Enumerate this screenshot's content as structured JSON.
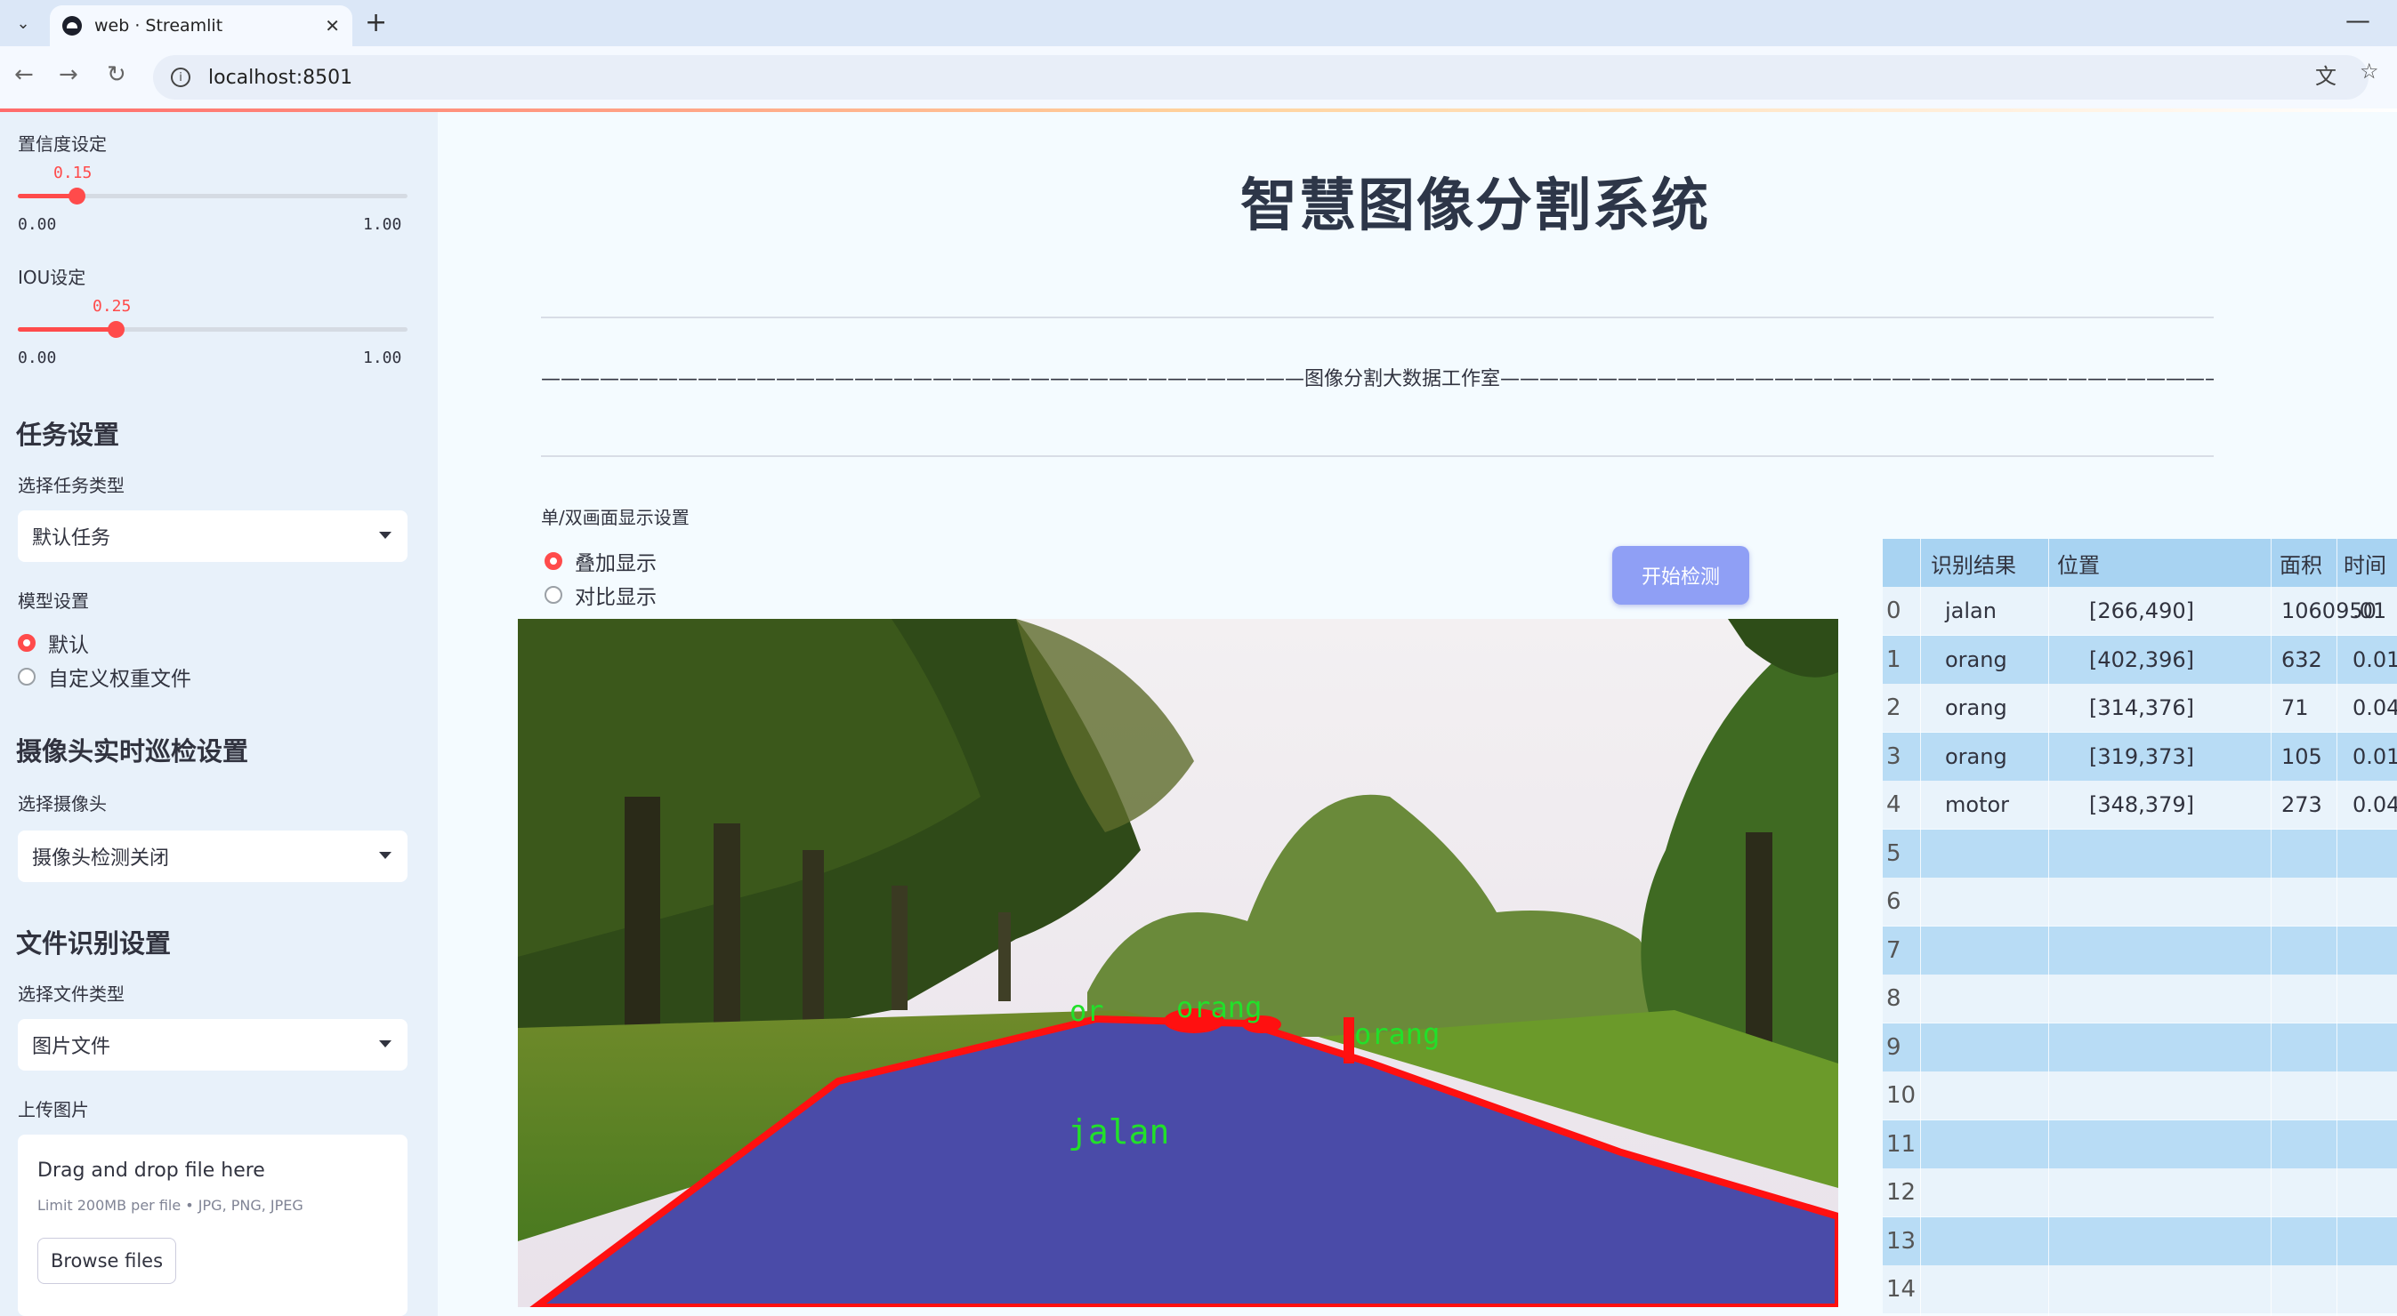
{
  "browser": {
    "tab_title": "web · Streamlit",
    "url": "localhost:8501"
  },
  "sidebar": {
    "confidence": {
      "label": "置信度设定",
      "value": "0.15",
      "min": "0.00",
      "max": "1.00",
      "fraction": 0.15
    },
    "iou": {
      "label": "IOU设定",
      "value": "0.25",
      "min": "0.00",
      "max": "1.00",
      "fraction": 0.25
    },
    "task_heading": "任务设置",
    "task_type_label": "选择任务类型",
    "task_type_value": "默认任务",
    "model_label": "模型设置",
    "model_options": [
      "默认",
      "自定义权重文件"
    ],
    "camera_heading": "摄像头实时巡检设置",
    "camera_label": "选择摄像头",
    "camera_value": "摄像头检测关闭",
    "file_heading": "文件识别设置",
    "file_type_label": "选择文件类型",
    "file_type_value": "图片文件",
    "upload_label": "上传图片",
    "upload_title": "Drag and drop file here",
    "upload_limit": "Limit 200MB per file • JPG, PNG, JPEG",
    "upload_button": "Browse files"
  },
  "main": {
    "title": "智慧图像分割系统",
    "subtitle": "———————————————————————————————————————图像分割大数据工作室——————————————————————————————————————",
    "display_label": "单/双画面显示设置",
    "display_options": [
      "叠加显示",
      "对比显示"
    ],
    "detect_button": "开始检测",
    "image_labels": {
      "road": "jalan",
      "person": "orang",
      "motor": "or"
    }
  },
  "table": {
    "headers": [
      "识别结果",
      "位置",
      "面积",
      "时间"
    ],
    "rows": [
      {
        "idx": "0",
        "label": "jalan",
        "pos": "[266,490]",
        "area": "1060950",
        "time": ".01"
      },
      {
        "idx": "1",
        "label": "orang",
        "pos": "[402,396]",
        "area": "632",
        "time": "0.01"
      },
      {
        "idx": "2",
        "label": "orang",
        "pos": "[314,376]",
        "area": "71",
        "time": "0.04"
      },
      {
        "idx": "3",
        "label": "orang",
        "pos": "[319,373]",
        "area": "105",
        "time": "0.01"
      },
      {
        "idx": "4",
        "label": "motor",
        "pos": "[348,379]",
        "area": "273",
        "time": "0.04"
      },
      {
        "idx": "5"
      },
      {
        "idx": "6"
      },
      {
        "idx": "7"
      },
      {
        "idx": "8"
      },
      {
        "idx": "9"
      },
      {
        "idx": "10"
      },
      {
        "idx": "11"
      },
      {
        "idx": "12"
      },
      {
        "idx": "13"
      },
      {
        "idx": "14"
      }
    ]
  },
  "colors": {
    "accent": "#ff4b4b",
    "button": "#8f9ff5",
    "mask": "#4a4ba8",
    "outline": "#ff1010",
    "label_text": "#22e02a"
  }
}
